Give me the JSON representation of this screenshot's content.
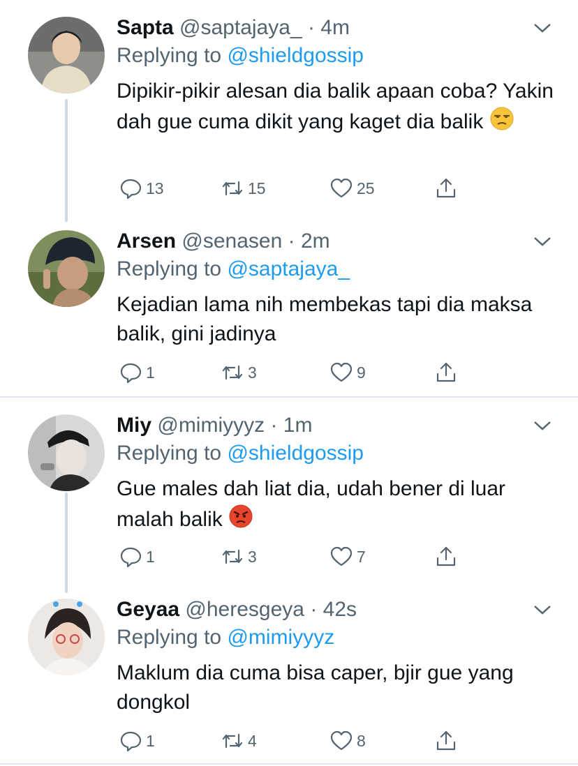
{
  "tweets": [
    {
      "name": "Sapta",
      "handle": "@saptajaya_",
      "time": "· 4m",
      "replying_prefix": "Replying to",
      "replying_to": "@shieldgossip",
      "text": "Dipikir-pikir alesan dia balik apaan coba? Yakin dah gue cuma dikit yang kaget dia balik",
      "emoji": "unamused-face",
      "replies": "13",
      "retweets": "15",
      "likes": "25"
    },
    {
      "name": "Arsen",
      "handle": "@senasen",
      "time": "· 2m",
      "replying_prefix": "Replying to",
      "replying_to": "@saptajaya_",
      "text": "Kejadian lama nih membekas tapi dia maksa balik, gini jadinya",
      "replies": "1",
      "retweets": "3",
      "likes": "9"
    },
    {
      "name": "Miy",
      "handle": "@mimiyyyz",
      "time": "· 1m",
      "replying_prefix": "Replying to",
      "replying_to": "@shieldgossip",
      "text": "Gue males dah liat dia, udah bener di luar malah balik",
      "emoji": "angry-face",
      "replies": "1",
      "retweets": "3",
      "likes": "7"
    },
    {
      "name": "Geyaa",
      "handle": "@heresgeya",
      "time": "· 42s",
      "replying_prefix": "Replying to",
      "replying_to": "@mimiyyyz",
      "text": "Maklum dia cuma bisa caper, bjir gue yang dongkol",
      "replies": "1",
      "retweets": "4",
      "likes": "8"
    }
  ],
  "colors": {
    "link": "#1d9bf0",
    "muted": "#536471",
    "text": "#0f1419",
    "thread_line": "#cfd9de"
  }
}
